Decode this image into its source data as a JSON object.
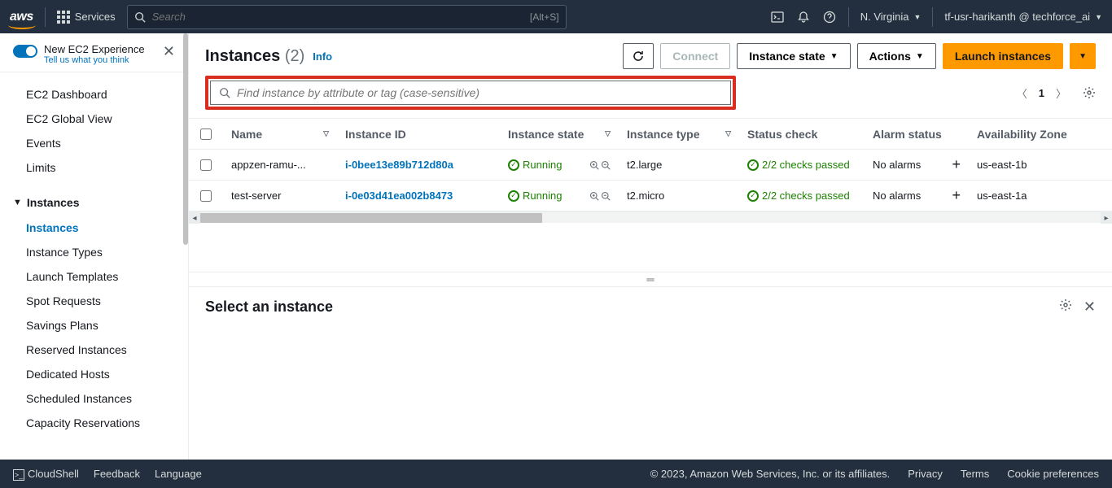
{
  "topbar": {
    "logo": "aws",
    "services": "Services",
    "search_placeholder": "Search",
    "search_shortcut": "[Alt+S]",
    "region": "N. Virginia",
    "account": "tf-usr-harikanth @ techforce_ai"
  },
  "sidebar": {
    "new_experience_title": "New EC2 Experience",
    "new_experience_sub": "Tell us what you think",
    "items_top": [
      "EC2 Dashboard",
      "EC2 Global View",
      "Events",
      "Limits"
    ],
    "section": "Instances",
    "items_section": [
      "Instances",
      "Instance Types",
      "Launch Templates",
      "Spot Requests",
      "Savings Plans",
      "Reserved Instances",
      "Dedicated Hosts",
      "Scheduled Instances",
      "Capacity Reservations"
    ]
  },
  "page": {
    "title": "Instances",
    "count": "(2)",
    "info": "Info",
    "btn_connect": "Connect",
    "btn_state": "Instance state",
    "btn_actions": "Actions",
    "btn_launch": "Launch instances",
    "filter_placeholder": "Find instance by attribute or tag (case-sensitive)",
    "page_num": "1"
  },
  "table": {
    "headers": {
      "name": "Name",
      "id": "Instance ID",
      "state": "Instance state",
      "type": "Instance type",
      "status": "Status check",
      "alarm": "Alarm status",
      "az": "Availability Zone"
    },
    "rows": [
      {
        "name": "appzen-ramu-...",
        "id": "i-0bee13e89b712d80a",
        "state": "Running",
        "type": "t2.large",
        "status": "2/2 checks passed",
        "alarm": "No alarms",
        "az": "us-east-1b"
      },
      {
        "name": "test-server",
        "id": "i-0e03d41ea002b8473",
        "state": "Running",
        "type": "t2.micro",
        "status": "2/2 checks passed",
        "alarm": "No alarms",
        "az": "us-east-1a"
      }
    ]
  },
  "detail": {
    "title": "Select an instance"
  },
  "footer": {
    "cloudshell": "CloudShell",
    "feedback": "Feedback",
    "language": "Language",
    "copyright": "© 2023, Amazon Web Services, Inc. or its affiliates.",
    "privacy": "Privacy",
    "terms": "Terms",
    "cookies": "Cookie preferences"
  }
}
